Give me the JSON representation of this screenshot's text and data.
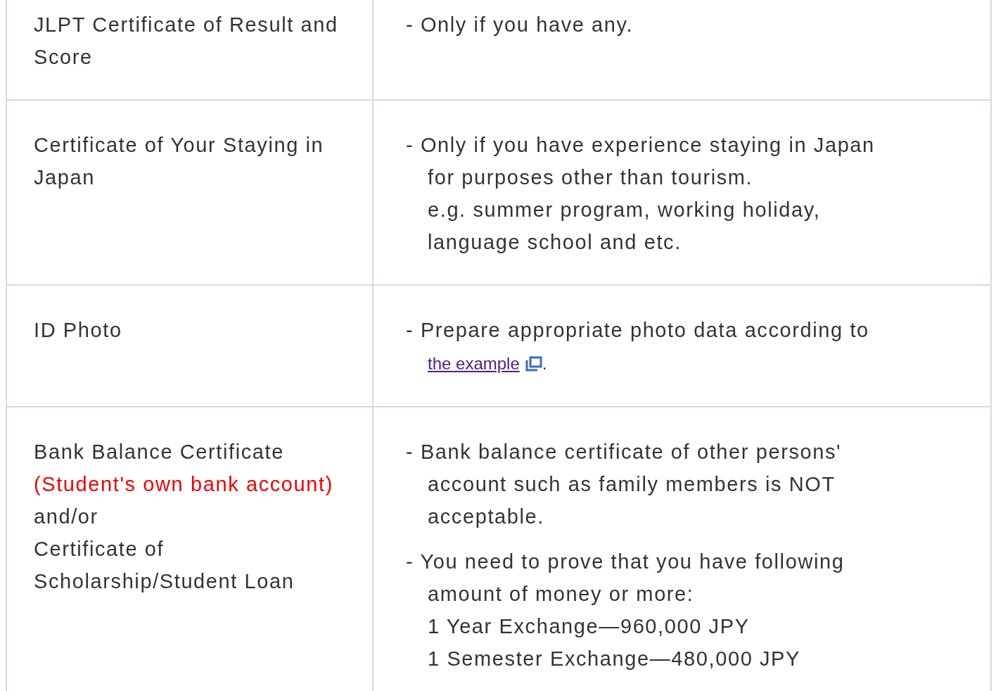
{
  "rows": [
    {
      "label_parts": [
        {
          "text": "JLPT Certificate of Result and Score",
          "emphasis": false
        }
      ],
      "notes": [
        {
          "text": "- Only if you have any."
        }
      ]
    },
    {
      "label_parts": [
        {
          "text": "Certificate of Your Staying in Japan",
          "emphasis": false
        }
      ],
      "notes": [
        {
          "text": "- Only if you have experience staying in Japan\nfor purposes other than tourism.\ne.g. summer program, working holiday,\nlanguage school and etc."
        }
      ]
    },
    {
      "label_parts": [
        {
          "text": "ID Photo",
          "emphasis": false
        }
      ],
      "notes": [
        {
          "text": "- Prepare appropriate photo data according to",
          "link": "the example",
          "after": "."
        }
      ]
    },
    {
      "label_parts": [
        {
          "text": "Bank Balance Certificate",
          "emphasis": false
        },
        {
          "text": "(Student's own bank account)",
          "emphasis": true
        },
        {
          "text": "and/or",
          "emphasis": false
        },
        {
          "text": "Certificate of Scholarship/Student Loan",
          "emphasis": false
        }
      ],
      "notes": [
        {
          "text": "- Bank balance certificate of other persons'\naccount such as family members is NOT\nacceptable."
        },
        {
          "text": "- You need to prove that you have following\namount of money or more:\n1 Year Exchange—960,000 JPY\n1 Semester Exchange—480,000 JPY"
        }
      ]
    }
  ]
}
